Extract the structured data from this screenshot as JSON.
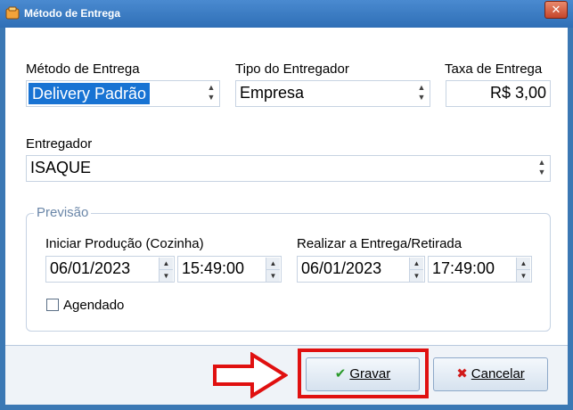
{
  "window": {
    "title": "Método de Entrega",
    "close_glyph": "✕"
  },
  "form": {
    "metodo_label": "Método de Entrega",
    "metodo_value": "Delivery Padrão",
    "tipo_label": "Tipo do Entregador",
    "tipo_value": "Empresa",
    "taxa_label": "Taxa de Entrega",
    "taxa_value": "R$ 3,00",
    "entregador_label": "Entregador",
    "entregador_value": "ISAQUE"
  },
  "previsao": {
    "group_title": "Previsão",
    "inicio_label": "Iniciar Produção (Cozinha)",
    "inicio_date": "06/01/2023",
    "inicio_time": "15:49:00",
    "entrega_label": "Realizar a Entrega/Retirada",
    "entrega_date": "06/01/2023",
    "entrega_time": "17:49:00",
    "agendado_label": "Agendado"
  },
  "buttons": {
    "gravar_label": "Gravar",
    "cancelar_label": "Cancelar"
  },
  "colors": {
    "title_bar": "#2f6fb6",
    "selection": "#1873d3",
    "highlight_frame": "#e01010",
    "annotation_arrow": "#e01010"
  }
}
